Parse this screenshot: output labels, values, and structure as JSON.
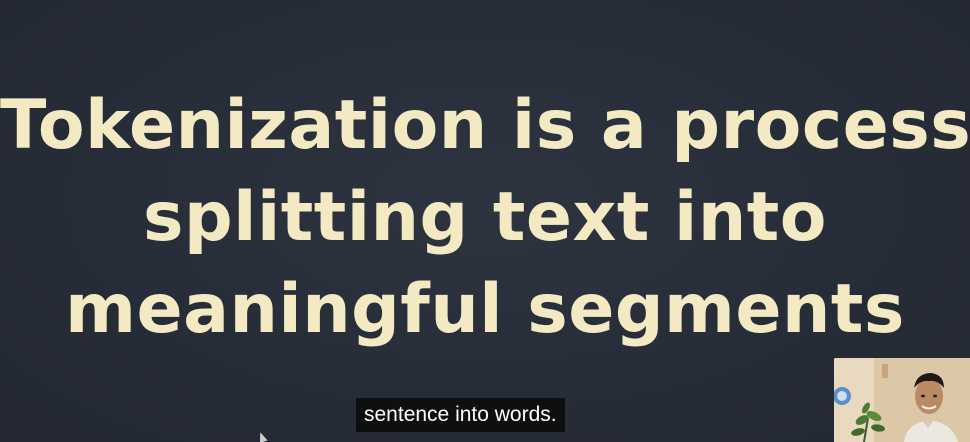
{
  "slide": {
    "headline_lines": [
      "Tokenization is a process of",
      "splitting text into",
      "meaningful segments"
    ]
  },
  "subtitle": {
    "text": "sentence into words."
  },
  "webcam": {
    "icon": "presenter-webcam-icon"
  },
  "colors": {
    "background": "#272d38",
    "headline_text": "#f3e9c3",
    "caption_background": "#0d0d0d",
    "caption_text": "#ffffff"
  }
}
